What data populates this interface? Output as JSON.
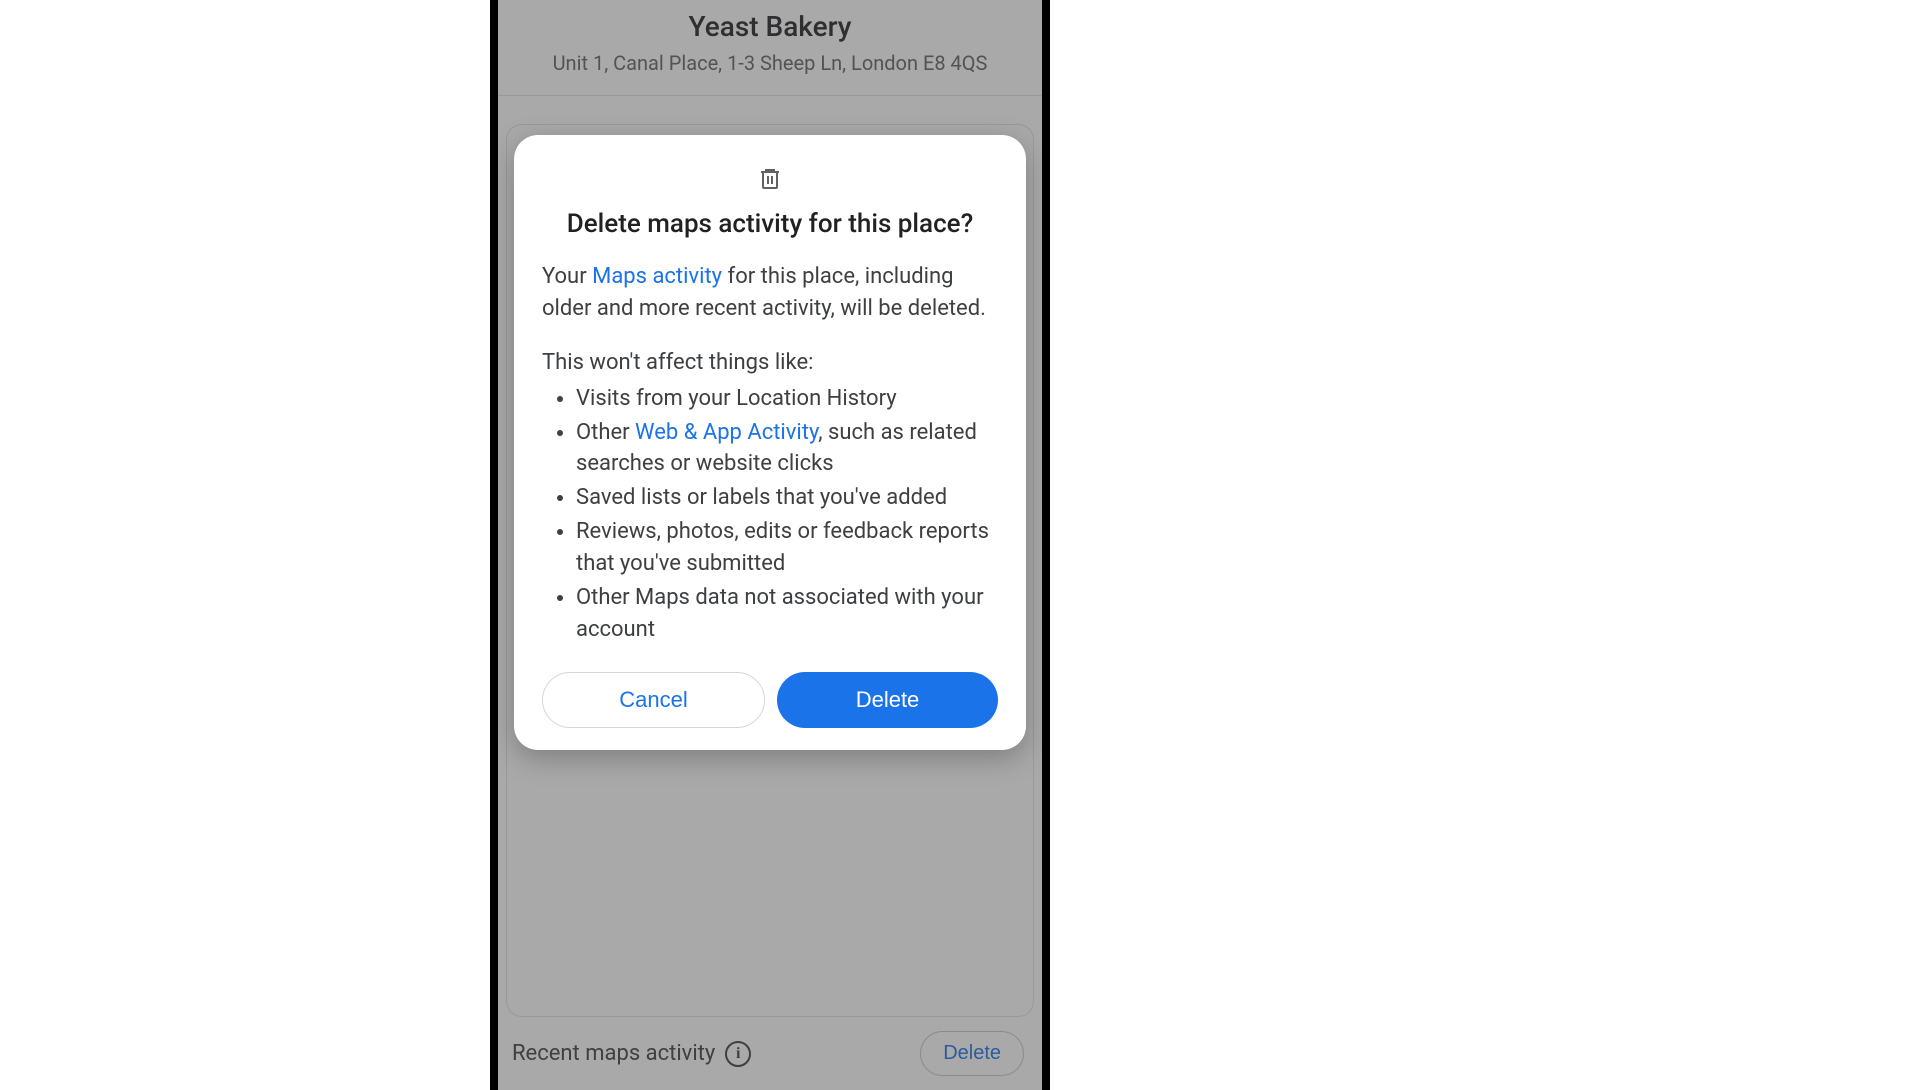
{
  "place": {
    "name": "Yeast Bakery",
    "address": "Unit 1, Canal Place, 1-3 Sheep Ln, London E8 4QS"
  },
  "recent_activity": {
    "label": "Recent maps activity",
    "delete_label": "Delete"
  },
  "dialog": {
    "title": "Delete maps activity for this place?",
    "body_prefix": "Your ",
    "body_link1": "Maps activity",
    "body_suffix": " for this place, including older and more recent activity, will be deleted.",
    "unaffected_intro": "This won't affect things like:",
    "items": {
      "i0": "Visits from your Location History",
      "i1_prefix": "Other ",
      "i1_link": "Web & App Activity",
      "i1_suffix": ", such as related searches or website clicks",
      "i2": "Saved lists or labels that you've added",
      "i3": "Reviews, photos, edits or feedback reports that you've submitted",
      "i4": "Other Maps data not associated with your account"
    },
    "cancel_label": "Cancel",
    "delete_label": "Delete"
  }
}
